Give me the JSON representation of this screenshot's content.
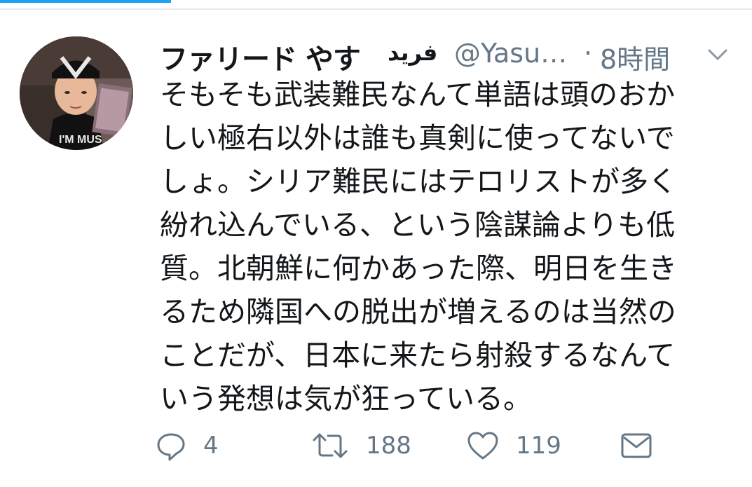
{
  "tweet": {
    "display_name": "ファリード やす",
    "display_name_arabic": "فريد",
    "handle": "@Yasu…",
    "separator": "·",
    "timestamp": "8時間",
    "text_lines": [
      "そもそも武装難民なんて単語は頭のおか",
      "しい極右以外は誰も真剣に使ってないで",
      "しょ。シリア難民にはテロリストが多く",
      "紛れ込んでいる、という陰謀論よりも低",
      "質。北朝鮮に何かあった際、明日を生き",
      "るため隣国への脱出が増えるのは当然の",
      "ことだが、日本に来たら射殺するなんて",
      "いう発想は気が狂っている。"
    ]
  },
  "actions": {
    "reply_count": "4",
    "retweet_count": "188",
    "like_count": "119"
  },
  "icons": {
    "reply": "reply-icon",
    "retweet": "retweet-icon",
    "like": "heart-icon",
    "dm": "envelope-icon",
    "caret": "chevron-down-icon"
  },
  "colors": {
    "accent": "#1da1f2",
    "text": "#14171a",
    "secondary_text": "#657786",
    "divider": "#e6ecf0"
  }
}
